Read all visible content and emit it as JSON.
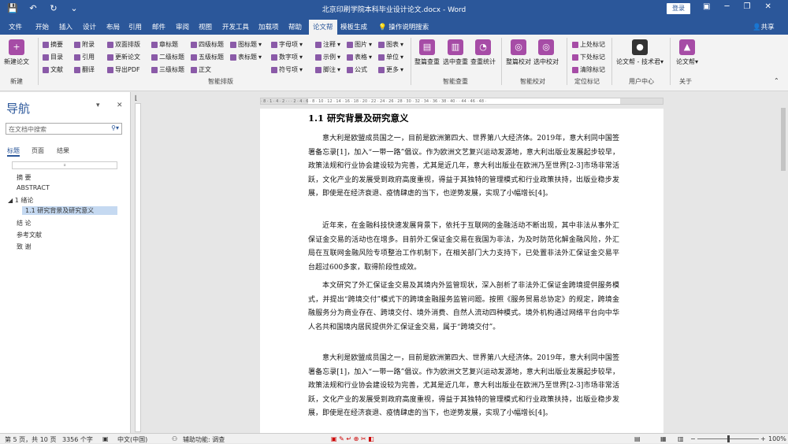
{
  "title_bar": {
    "doc_title": "北京印刷学院本科毕业设计论文.docx - Word",
    "login": "登录",
    "qat": {
      "save_icon": "💾",
      "undo_icon": "↶",
      "redo_icon": "↻",
      "customize_icon": "⌄"
    },
    "window_controls": {
      "ribbon_options": "▣",
      "minimize": "─",
      "restore": "❐",
      "close": "✕"
    }
  },
  "tabs": [
    "文件",
    "开始",
    "插入",
    "设计",
    "布局",
    "引用",
    "邮件",
    "审阅",
    "视图",
    "开发工具",
    "加载项",
    "帮助",
    "论文帮",
    "模板生成"
  ],
  "tell_me": "操作说明搜索",
  "share": "共享",
  "ribbon": {
    "new_paper": "新建论文",
    "group_new": "新建",
    "col1": [
      "摘要",
      "目录",
      "文献"
    ],
    "col2": [
      "附录",
      "引用",
      "翻译"
    ],
    "col3": [
      "双面排版",
      "更新论文",
      "导出PDF"
    ],
    "col4": [
      "章标题",
      "二级标题",
      "三级标题"
    ],
    "col5": [
      "四级标题",
      "五级标题",
      "正文"
    ],
    "col6": [
      "图标题",
      "表标题"
    ],
    "col7": [
      "字母项",
      "数字项",
      "符号项"
    ],
    "col8": [
      "注释",
      "示例",
      "脚注"
    ],
    "col9": [
      "图片",
      "表格",
      "公式"
    ],
    "col10": [
      "图表",
      "单位",
      "更多"
    ],
    "group_format": "智能排版",
    "check": [
      "整篇查重",
      "选中查重",
      "查重统计"
    ],
    "group_check": "智能查重",
    "proof": [
      "整篇校对",
      "选中校对"
    ],
    "group_proof": "智能校对",
    "marks": [
      "上处标记",
      "下处标记",
      "清除标记"
    ],
    "group_marks": "定位标记",
    "user": "论文帮 - 技术君",
    "group_user": "用户中心",
    "about": "论文帮",
    "group_about": "关于"
  },
  "nav": {
    "title": "导航",
    "search_placeholder": "在文档中搜索",
    "tabs": [
      "标题",
      "页面",
      "结果"
    ],
    "collapse_bar": "⌅",
    "headings": [
      "摘 要",
      "ABSTRACT",
      "1  绪论",
      "1.1  研究背景及研究意义",
      "结 论",
      "参考文献",
      "致 谢"
    ]
  },
  "document": {
    "heading": "1.1  研究背景及研究意义",
    "p1": "意大利是欧盟成员国之一，目前是欧洲第四大、世界第八大经济体。2019年，意大利同中国签署备忘录[1]，加入“一带一路”倡议。作为欧洲文艺复兴运动发源地，意大利出版业发展起步较早，政策法规和行业协会建设较为完善，尤其是近几年，意大利出版业在欧洲乃至世界[2-3]市场非常活跃，文化产业的发展受到政府高度重视，得益于其独特的管理模式和行业政策扶持，出版业稳步发展，即使是在经济衰退、疫情肆虐的当下，也逆势发展，实现了小幅增长[4]。",
    "p2": "近年来，在金融科技快速发展背景下，依托于互联网的金融活动不断出现，其中非法从事外汇保证金交易的活动也在增多。目前外汇保证金交易在我国为非法，为及时防范化解金融风险，外汇局在互联网金融风险专项整治工作机制下，在相关部门大力支持下，已处置非法外汇保证金交易平台超过600多家，取得阶段性成效。",
    "p3": "本文研究了外汇保证金交易及其境内外监管现状，深入剖析了非法外汇保证金跨境提供服务模式，并提出“跨境交付”模式下的跨境金融服务监管问题。按照《服务贸易总协定》的规定，跨境金融服务分为商业存在、跨境交付、境外消费、自然人流动四种模式。境外机构通过网络平台向中华人名共和国境内居民提供外汇保证金交易，属于“跨境交付”。",
    "p4": "意大利是欧盟成员国之一，目前是欧洲第四大、世界第八大经济体。2019年，意大利同中国签署备忘录[1]，加入“一带一路”倡议。作为欧洲文艺复兴运动发源地，意大利出版业发展起步较早，政策法规和行业协会建设较为完善，尤其是近几年，意大利出版业在欧洲乃至世界[2-3]市场非常活跃，文化产业的发展受到政府高度重视，得益于其独特的管理模式和行业政策扶持，出版业稳步发展，即使是在经济衰退、疫情肆虐的当下，也逆势发展，实现了小幅增长[4]。"
  },
  "ruler": "· 8 · 1 · 4 · 2 ·  ·  · 2 · 4 · 6 · 8 · 10 · 12 · 14 · 16 · 18 · 20 · 22 · 24 · 26 · 28 · 30 · 32 · 34 · 36 · 38 · 40 ·  · 44 · 46 · 48 ·",
  "status": {
    "page": "第 5 页，共 10 页",
    "words": "3356 个字",
    "lang": "中文(中国)",
    "accessibility": "辅助功能: 调查",
    "zoom": "100%"
  }
}
